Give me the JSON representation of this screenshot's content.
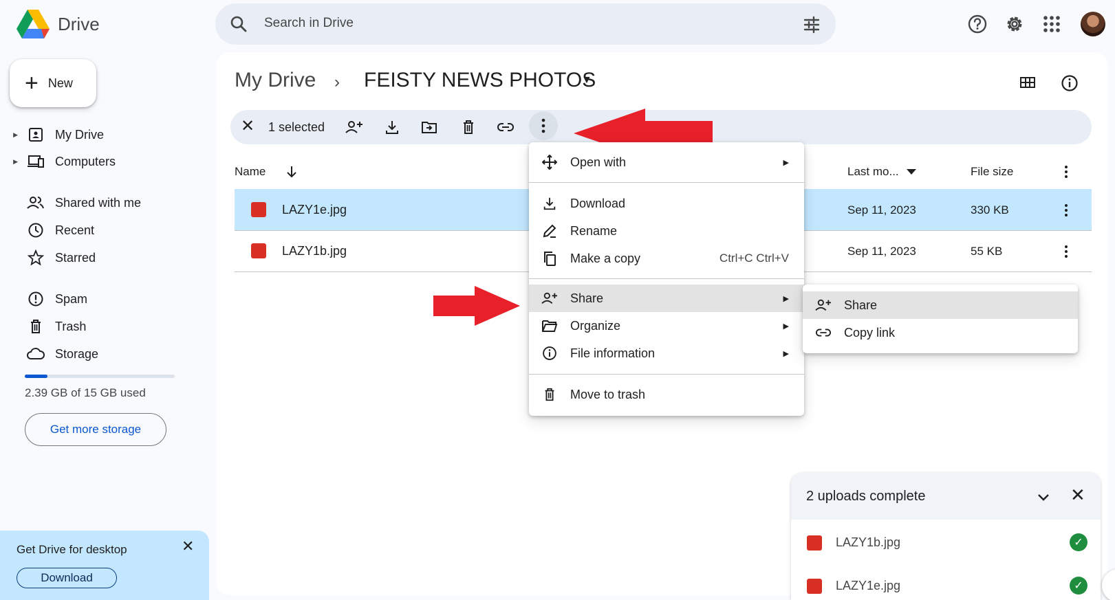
{
  "app": {
    "brand": "Drive"
  },
  "search": {
    "placeholder": "Search in Drive"
  },
  "sidebar": {
    "new_label": "New",
    "items": [
      {
        "label": "My Drive"
      },
      {
        "label": "Computers"
      },
      {
        "label": "Shared with me"
      },
      {
        "label": "Recent"
      },
      {
        "label": "Starred"
      },
      {
        "label": "Spam"
      },
      {
        "label": "Trash"
      },
      {
        "label": "Storage"
      }
    ],
    "storage_text": "2.39 GB of 15 GB used",
    "storage_used_fraction": 0.16,
    "get_storage": "Get more storage"
  },
  "promo": {
    "title": "Get Drive for desktop",
    "download": "Download",
    "close": "✕"
  },
  "breadcrumb": {
    "root": "My Drive",
    "sep": "›",
    "current": "FEISTY NEWS PHOTOS",
    "dropdown": "▼"
  },
  "selection": {
    "close": "✕",
    "count": "1 selected"
  },
  "columns": {
    "name": "Name",
    "modified": "Last mo...",
    "size": "File size"
  },
  "files": [
    {
      "name": "LAZY1e.jpg",
      "modified": "Sep 11, 2023",
      "size": "330 KB",
      "selected": true
    },
    {
      "name": "LAZY1b.jpg",
      "modified": "Sep 11, 2023",
      "size": "55 KB",
      "selected": false
    }
  ],
  "context_menu": {
    "open_with": "Open with",
    "download": "Download",
    "rename": "Rename",
    "make_copy": "Make a copy",
    "make_copy_shortcut": "Ctrl+C Ctrl+V",
    "share": "Share",
    "organize": "Organize",
    "file_info": "File information",
    "trash": "Move to trash",
    "arrow": "▶"
  },
  "share_submenu": {
    "share": "Share",
    "copy_link": "Copy link"
  },
  "uploads": {
    "title": "2 uploads complete",
    "close": "✕",
    "items": [
      {
        "name": "LAZY1b.jpg",
        "check": "✓"
      },
      {
        "name": "LAZY1e.jpg",
        "check": "✓"
      }
    ]
  },
  "colors": {
    "accent": "#0b57d0",
    "selected_row": "#c2e7ff",
    "annotation_arrow": "#e8202a",
    "check": "#1e8e3e"
  }
}
